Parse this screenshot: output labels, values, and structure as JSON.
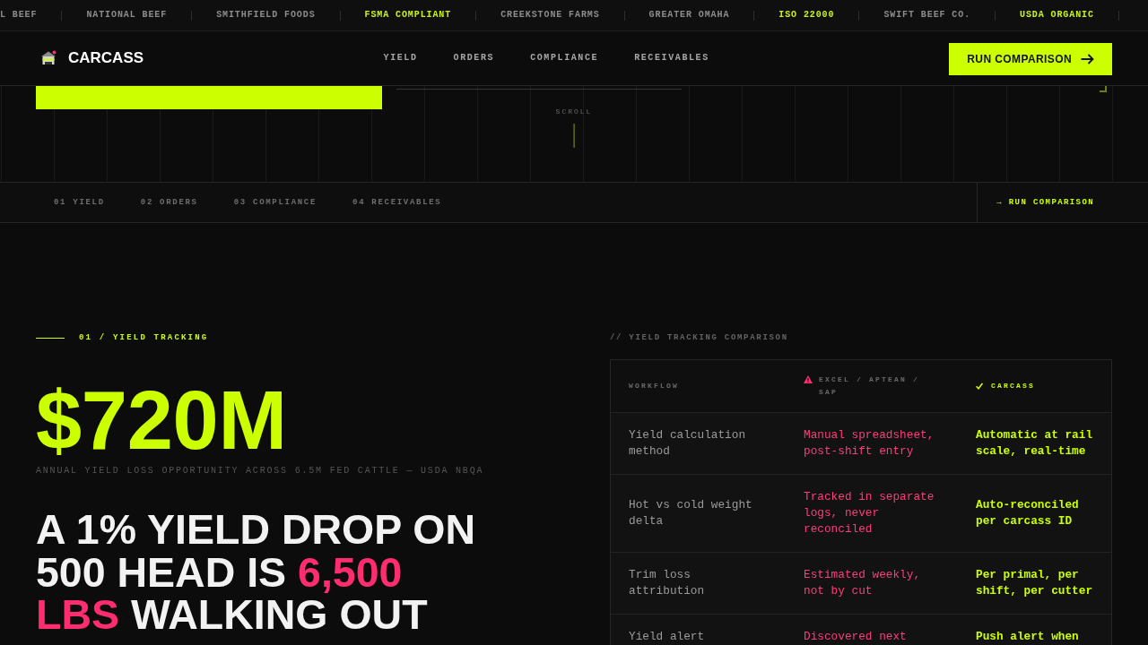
{
  "ticker": [
    {
      "label": "L BEEF",
      "kind": "partner"
    },
    {
      "label": "NATIONAL BEEF",
      "kind": "partner"
    },
    {
      "label": "SMITHFIELD FOODS",
      "kind": "partner"
    },
    {
      "label": "FSMA COMPLIANT",
      "kind": "certification"
    },
    {
      "label": "CREEKSTONE FARMS",
      "kind": "partner"
    },
    {
      "label": "GREATER OMAHA",
      "kind": "partner"
    },
    {
      "label": "ISO 22000",
      "kind": "certification"
    },
    {
      "label": "SWIFT BEEF CO.",
      "kind": "partner"
    },
    {
      "label": "USDA ORGANIC",
      "kind": "certification"
    }
  ],
  "nav": {
    "brand": "CARCASS",
    "links": [
      "YIELD",
      "ORDERS",
      "COMPLIANCE",
      "RECEIVABLES"
    ],
    "cta": "RUN COMPARISON"
  },
  "hero": {
    "scroll_label": "SCROLL"
  },
  "section_nav": {
    "items": [
      "01 YIELD",
      "02 ORDERS",
      "03 COMPLIANCE",
      "04 RECEIVABLES"
    ],
    "cta": "→ RUN COMPARISON"
  },
  "yield_section": {
    "eyebrow": "01 / YIELD TRACKING",
    "stat": "$720M",
    "stat_caption": "ANNUAL YIELD LOSS OPPORTUNITY ACROSS 6.5M FED CATTLE — USDA NBQA",
    "headline": [
      {
        "text": "A 1% YIELD DROP ON 500 HEAD IS ",
        "highlight": false
      },
      {
        "text": "6,500 LBS",
        "highlight": true
      },
      {
        "text": " WALKING OUT",
        "highlight": false
      }
    ]
  },
  "comparison": {
    "caption": "// YIELD TRACKING COMPARISON",
    "columns": [
      {
        "label": "WORKFLOW",
        "kind": "criterion"
      },
      {
        "label": "EXCEL / APTEAN / SAP",
        "kind": "legacy"
      },
      {
        "label": "CARCASS",
        "kind": "carcass"
      }
    ],
    "rows": [
      [
        "Yield calculation method",
        "Manual spreadsheet, post-shift entry",
        "Automatic at rail scale, real-time"
      ],
      [
        "Hot vs cold weight delta",
        "Tracked in separate logs, never reconciled",
        "Auto-reconciled per carcass ID"
      ],
      [
        "Trim loss attribution",
        "Estimated weekly, not by cut",
        "Per primal, per shift, per cutter"
      ],
      [
        "Yield alert",
        "Discovered next",
        "Push alert when"
      ]
    ]
  }
}
